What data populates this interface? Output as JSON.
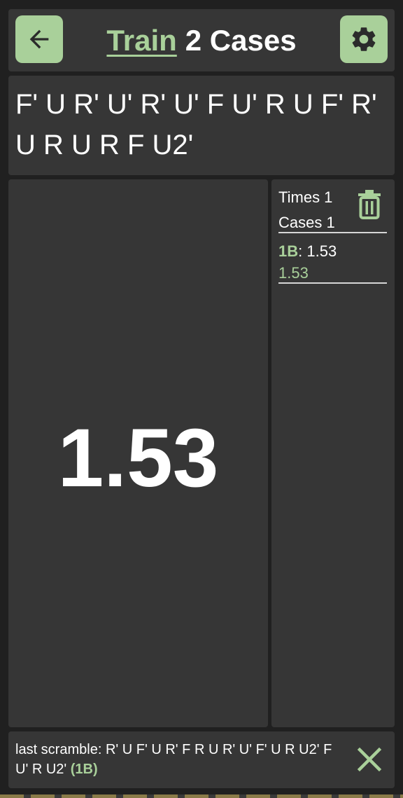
{
  "header": {
    "back_icon": "arrow-left-icon",
    "title_link": "Train",
    "title_suffix": "2 Cases",
    "settings_icon": "gear-icon"
  },
  "scramble": {
    "text": "F' U R' U' R' U' F U' R U F' R' U R U R F U2'"
  },
  "timer": {
    "value": "1.53"
  },
  "stats": {
    "times_label": "Times 1",
    "cases_label": "Cases 1",
    "delete_icon": "trash-icon",
    "results": [
      {
        "case": "1B",
        "separator": ": ",
        "time": "1.53"
      }
    ],
    "average": "1.53"
  },
  "footer": {
    "prefix": "last scramble: ",
    "scramble": "R' U F' U R' F R U R' U' F' U R U2' F U' R U2'",
    "case_label": "(1B)",
    "close_icon": "close-icon"
  },
  "colors": {
    "accent": "#a9d09a",
    "panel": "#363636",
    "background": "#202020",
    "text": "#ffffff"
  }
}
